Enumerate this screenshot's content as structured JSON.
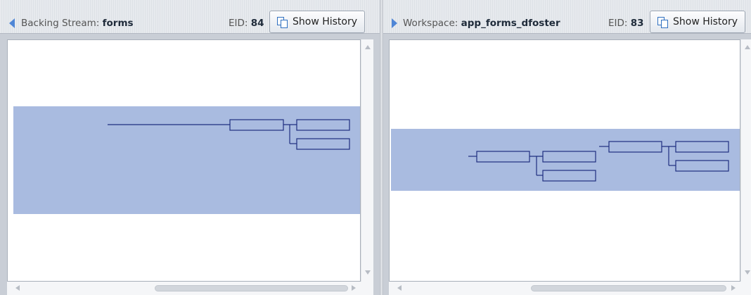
{
  "left": {
    "label": "Backing Stream:",
    "name": "forms",
    "eid_label": "EID:",
    "eid_value": "84",
    "button": "Show History"
  },
  "right": {
    "label": "Workspace:",
    "name": "app_forms_dfoster",
    "eid_label": "EID:",
    "eid_value": "83",
    "button": "Show History"
  },
  "colors": {
    "highlight_band": "#a9bbe0",
    "node_stroke": "#1e2f7f",
    "arrow": "#4f86d6"
  },
  "icons": [
    "collapse-arrow-left",
    "expand-arrow-right",
    "history-icon",
    "scroll-arrow-up",
    "scroll-arrow-down",
    "scroll-arrow-left",
    "scroll-arrow-right"
  ]
}
